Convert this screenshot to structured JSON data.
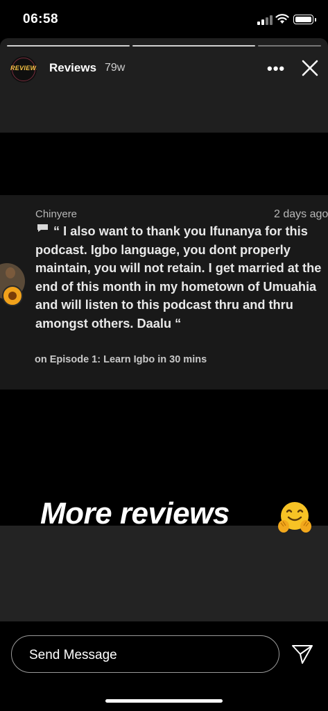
{
  "status_bar": {
    "time": "06:58"
  },
  "story": {
    "avatar_text": "REVIEWS",
    "username": "Reviews",
    "age": "79w",
    "more_label": "•••",
    "progress_segments": 3,
    "active_segment": 3
  },
  "comment": {
    "author": "Chinyere",
    "date": "2 days ago",
    "text": "“ I also want to thank you Ifunanya for this podcast. Igbo language, you dont properly maintain, you will not retain. I get married at the end of this month in my hometown of Umuahia and will listen to this podcast thru and thru amongst others. Daalu “",
    "episode": "on Episode 1: Learn Igbo in 30 mins"
  },
  "overlay": {
    "headline": "More reviews",
    "emoji_icon": "hugging-face-emoji"
  },
  "reply": {
    "placeholder": "Send Message"
  },
  "colors": {
    "card_bg": "#1f1f1f",
    "comment_bg": "#191919",
    "badge": "#f1a21b"
  }
}
